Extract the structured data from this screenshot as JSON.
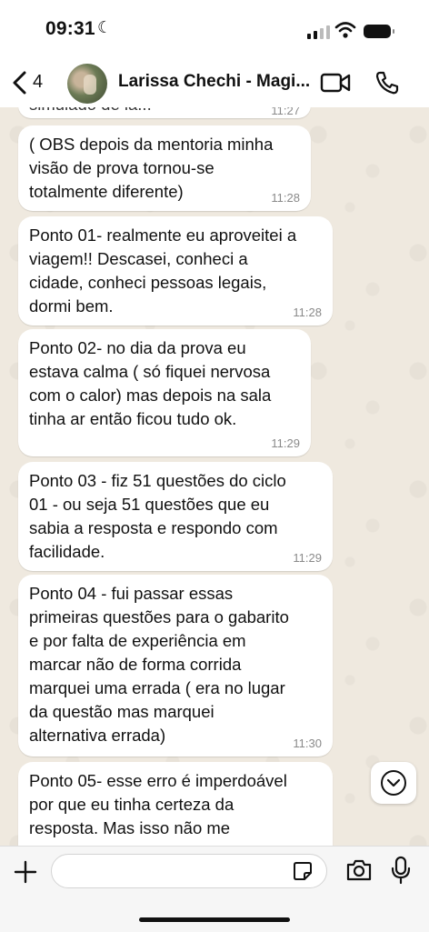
{
  "status_bar": {
    "time": "09:31"
  },
  "header": {
    "back_count": "4",
    "contact_name": "Larissa Chechi - Magi..."
  },
  "messages": [
    {
      "text": "simulado de lá...",
      "time": "11:27"
    },
    {
      "text": "( OBS depois da mentoria minha\nvisão de prova tornou-se\ntotalmente diferente)",
      "time": "11:28"
    },
    {
      "text": "Ponto 01- realmente eu aproveitei a\nviagem!! Descasei, conheci a\ncidade, conheci pessoas legais,\ndormi bem.",
      "time": "11:28"
    },
    {
      "text": "Ponto 02- no dia da prova eu\nestava calma ( só fiquei nervosa\ncom o calor) mas depois na sala\ntinha ar então ficou tudo ok.",
      "time": "11:29"
    },
    {
      "text": "Ponto 03 - fiz 51 questões do ciclo\n01 - ou seja 51 questões que eu\nsabia a resposta e respondo com\nfacilidade.",
      "time": "11:29"
    },
    {
      "text": "Ponto 04 - fui passar essas\nprimeiras questões para o gabarito\ne por falta de experiência em\nmarcar não de forma corrida\nmarquei uma errada ( era no lugar\nda questão mas marquei\nalternativa errada)",
      "time": "11:30"
    },
    {
      "text": "Ponto 05- esse erro é imperdoável\npor que eu tinha certeza da\nresposta. Mas isso não me",
      "time": ""
    }
  ]
}
